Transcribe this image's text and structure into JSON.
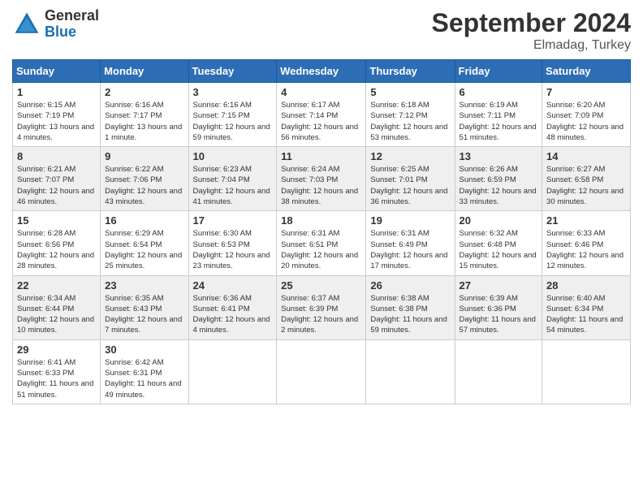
{
  "header": {
    "logo_general": "General",
    "logo_blue": "Blue",
    "month_title": "September 2024",
    "location": "Elmadag, Turkey"
  },
  "days_of_week": [
    "Sunday",
    "Monday",
    "Tuesday",
    "Wednesday",
    "Thursday",
    "Friday",
    "Saturday"
  ],
  "weeks": [
    [
      {
        "day": "1",
        "sunrise": "6:15 AM",
        "sunset": "7:19 PM",
        "daylight": "13 hours and 4 minutes."
      },
      {
        "day": "2",
        "sunrise": "6:16 AM",
        "sunset": "7:17 PM",
        "daylight": "13 hours and 1 minute."
      },
      {
        "day": "3",
        "sunrise": "6:16 AM",
        "sunset": "7:15 PM",
        "daylight": "12 hours and 59 minutes."
      },
      {
        "day": "4",
        "sunrise": "6:17 AM",
        "sunset": "7:14 PM",
        "daylight": "12 hours and 56 minutes."
      },
      {
        "day": "5",
        "sunrise": "6:18 AM",
        "sunset": "7:12 PM",
        "daylight": "12 hours and 53 minutes."
      },
      {
        "day": "6",
        "sunrise": "6:19 AM",
        "sunset": "7:11 PM",
        "daylight": "12 hours and 51 minutes."
      },
      {
        "day": "7",
        "sunrise": "6:20 AM",
        "sunset": "7:09 PM",
        "daylight": "12 hours and 48 minutes."
      }
    ],
    [
      {
        "day": "8",
        "sunrise": "6:21 AM",
        "sunset": "7:07 PM",
        "daylight": "12 hours and 46 minutes."
      },
      {
        "day": "9",
        "sunrise": "6:22 AM",
        "sunset": "7:06 PM",
        "daylight": "12 hours and 43 minutes."
      },
      {
        "day": "10",
        "sunrise": "6:23 AM",
        "sunset": "7:04 PM",
        "daylight": "12 hours and 41 minutes."
      },
      {
        "day": "11",
        "sunrise": "6:24 AM",
        "sunset": "7:03 PM",
        "daylight": "12 hours and 38 minutes."
      },
      {
        "day": "12",
        "sunrise": "6:25 AM",
        "sunset": "7:01 PM",
        "daylight": "12 hours and 36 minutes."
      },
      {
        "day": "13",
        "sunrise": "6:26 AM",
        "sunset": "6:59 PM",
        "daylight": "12 hours and 33 minutes."
      },
      {
        "day": "14",
        "sunrise": "6:27 AM",
        "sunset": "6:58 PM",
        "daylight": "12 hours and 30 minutes."
      }
    ],
    [
      {
        "day": "15",
        "sunrise": "6:28 AM",
        "sunset": "6:56 PM",
        "daylight": "12 hours and 28 minutes."
      },
      {
        "day": "16",
        "sunrise": "6:29 AM",
        "sunset": "6:54 PM",
        "daylight": "12 hours and 25 minutes."
      },
      {
        "day": "17",
        "sunrise": "6:30 AM",
        "sunset": "6:53 PM",
        "daylight": "12 hours and 23 minutes."
      },
      {
        "day": "18",
        "sunrise": "6:31 AM",
        "sunset": "6:51 PM",
        "daylight": "12 hours and 20 minutes."
      },
      {
        "day": "19",
        "sunrise": "6:31 AM",
        "sunset": "6:49 PM",
        "daylight": "12 hours and 17 minutes."
      },
      {
        "day": "20",
        "sunrise": "6:32 AM",
        "sunset": "6:48 PM",
        "daylight": "12 hours and 15 minutes."
      },
      {
        "day": "21",
        "sunrise": "6:33 AM",
        "sunset": "6:46 PM",
        "daylight": "12 hours and 12 minutes."
      }
    ],
    [
      {
        "day": "22",
        "sunrise": "6:34 AM",
        "sunset": "6:44 PM",
        "daylight": "12 hours and 10 minutes."
      },
      {
        "day": "23",
        "sunrise": "6:35 AM",
        "sunset": "6:43 PM",
        "daylight": "12 hours and 7 minutes."
      },
      {
        "day": "24",
        "sunrise": "6:36 AM",
        "sunset": "6:41 PM",
        "daylight": "12 hours and 4 minutes."
      },
      {
        "day": "25",
        "sunrise": "6:37 AM",
        "sunset": "6:39 PM",
        "daylight": "12 hours and 2 minutes."
      },
      {
        "day": "26",
        "sunrise": "6:38 AM",
        "sunset": "6:38 PM",
        "daylight": "11 hours and 59 minutes."
      },
      {
        "day": "27",
        "sunrise": "6:39 AM",
        "sunset": "6:36 PM",
        "daylight": "11 hours and 57 minutes."
      },
      {
        "day": "28",
        "sunrise": "6:40 AM",
        "sunset": "6:34 PM",
        "daylight": "11 hours and 54 minutes."
      }
    ],
    [
      {
        "day": "29",
        "sunrise": "6:41 AM",
        "sunset": "6:33 PM",
        "daylight": "11 hours and 51 minutes."
      },
      {
        "day": "30",
        "sunrise": "6:42 AM",
        "sunset": "6:31 PM",
        "daylight": "11 hours and 49 minutes."
      },
      null,
      null,
      null,
      null,
      null
    ]
  ]
}
